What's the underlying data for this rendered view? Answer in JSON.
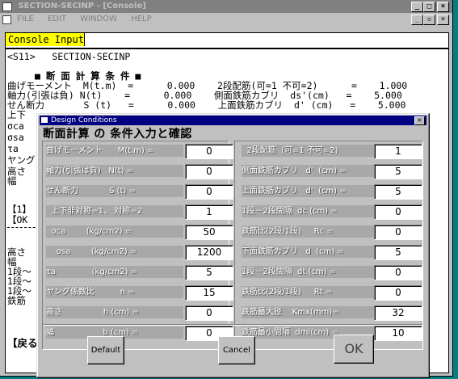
{
  "main_window": {
    "title": "SECTION-SECINP - [Console]",
    "menu": [
      "FILE",
      "EDIT",
      "WINDOW",
      "HELP"
    ],
    "console_label": "Console Input=",
    "console_value": "",
    "lines": [
      "<S11>   SECTION-SECINP",
      "■ 断 面 計 算 条 件 ■",
      "曲げモーメント  M(t.m)  =      0.000    2段配筋(可=1 不可=2)      =    1.000",
      "軸力(引張は負) N(t)    =      0.000    側面鉄筋カブリ  ds'(cm)   =    5.000",
      "せん断力       S (t)   =      0.000    上面鉄筋カブリ  d' (cm)   =    5.000",
      "上下",
      "σca",
      "σsa",
      "τa",
      "ヤング",
      "高さ",
      "幅",
      "【1】",
      "【OK",
      "高さ",
      "幅",
      "1段～",
      "1段～",
      "1段～",
      "鉄筋",
      "【戻る"
    ]
  },
  "dialog": {
    "title": "Design Conditions",
    "heading": "断面計算 の 条件入力と確認",
    "left_fields": [
      {
        "label": "曲げモーメント      M(t.m) =",
        "value": "0"
      },
      {
        "label": "軸力(引張は負)   N(t) =",
        "value": "0"
      },
      {
        "label": "せん断力            S (t) =",
        "value": "0"
      },
      {
        "label": "  上下非対称=1、 対称=2",
        "value": "1"
      },
      {
        "label": "  σca        (kg/cm2) =",
        "value": "50"
      },
      {
        "label": "    σsa        (kg/cm2) =",
        "value": "1200"
      },
      {
        "label": "τa              (kg/cm2) =",
        "value": "5"
      },
      {
        "label": "ヤング係数比          n =",
        "value": "15"
      },
      {
        "label": "高さ                h (cm) =",
        "value": "0"
      },
      {
        "label": "幅                   b (cm) =",
        "value": "0"
      }
    ],
    "right_fields": [
      {
        "label": "  2段配筋  (可=1 不可=2)",
        "value": "1"
      },
      {
        "label": "側面鉄筋カブリ   d'  (cm) =",
        "value": "5"
      },
      {
        "label": "上面鉄筋カブリ   d'  (cm) =",
        "value": "5"
      },
      {
        "label": "1段－2段間隔  dc (cm) =",
        "value": "0"
      },
      {
        "label": "鉄筋比(2段/1段)     Rc =",
        "value": "0"
      },
      {
        "label": "下面鉄筋カブリ   d  (cm) =",
        "value": "5"
      },
      {
        "label": "1段－2段間隔  dt (cm) =",
        "value": "0"
      },
      {
        "label": "鉄筋比(2段/1段)     Rt =",
        "value": "0"
      },
      {
        "label": "鉄筋最大径    Kmx(mm)=",
        "value": "32"
      },
      {
        "label": "鉄筋最小間隔  dmi(cm) =",
        "value": "10"
      }
    ],
    "buttons": {
      "default": "Default",
      "cancel": "Cancel",
      "ok": "OK"
    }
  }
}
